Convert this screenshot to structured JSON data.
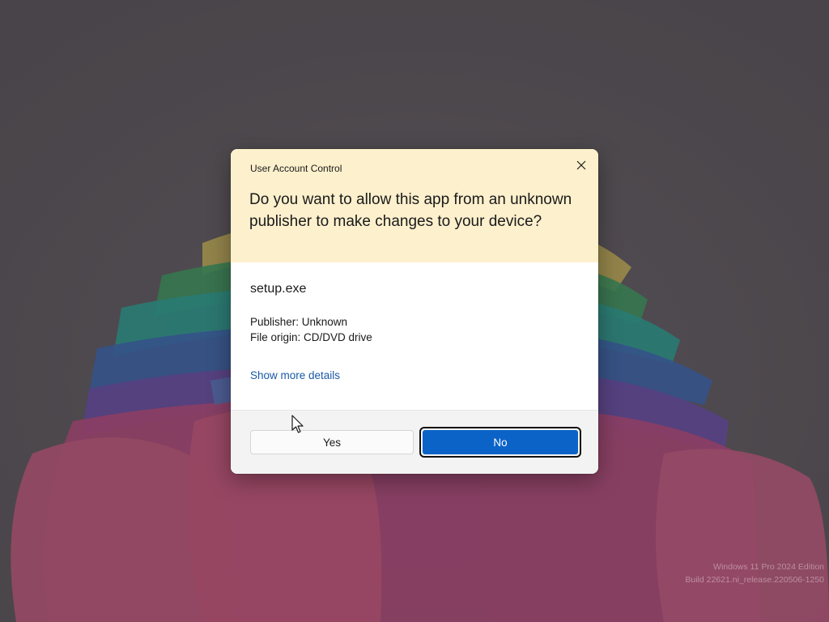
{
  "dialog": {
    "title": "User Account Control",
    "question": "Do you want to allow this app from an unknown publisher to make changes to your device?",
    "app_name": "setup.exe",
    "publisher": "Publisher: Unknown",
    "file_origin": "File origin: CD/DVD drive",
    "details_link": "Show more details",
    "yes_label": "Yes",
    "no_label": "No",
    "close_icon": "close-icon"
  },
  "watermark": {
    "line1": "Windows 11 Pro 2024 Edition",
    "line2": "Build 22621.ni_release.220506-1250"
  },
  "colors": {
    "header_bg": "#fdf0cd",
    "accent": "#0b63c8",
    "link": "#1a5aa7"
  }
}
